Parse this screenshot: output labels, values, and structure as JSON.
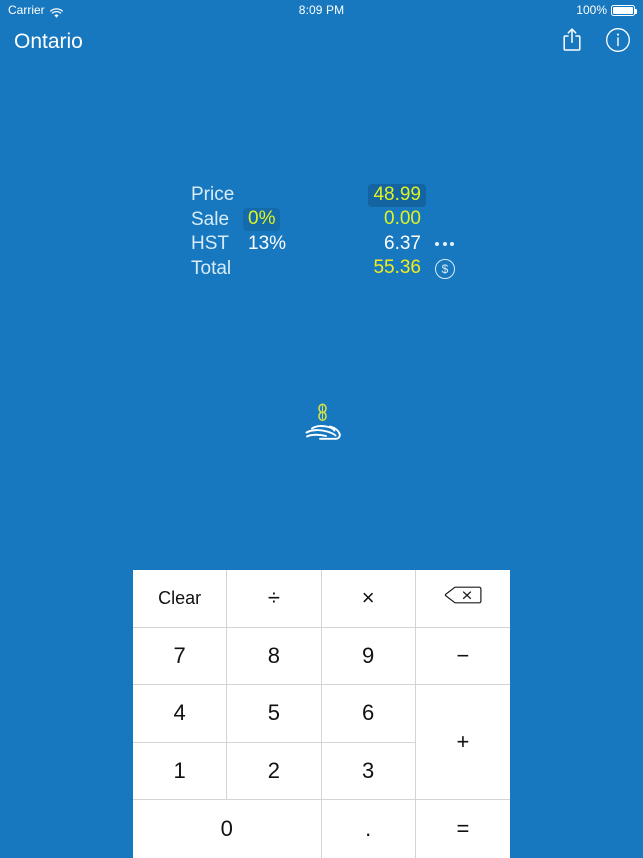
{
  "status_bar": {
    "carrier": "Carrier",
    "wifi_icon": "wifi-icon",
    "time": "8:09 PM",
    "battery_percent": "100%",
    "battery_icon": "battery-full-icon"
  },
  "nav_bar": {
    "title": "Ontario",
    "share_icon": "share-icon",
    "info_icon": "info-circle-icon"
  },
  "receipt": {
    "rows": [
      {
        "label": "Price",
        "percent": "",
        "value": "48.99",
        "value_style": "green boxed",
        "trailing": ""
      },
      {
        "label": "Sale",
        "percent": "0%",
        "value": "0.00",
        "value_style": "green",
        "trailing": ""
      },
      {
        "label": "HST",
        "percent": "13%",
        "value": "6.37",
        "value_style": "white",
        "trailing": "more-dots-icon"
      },
      {
        "label": "Total",
        "percent": "",
        "value": "55.36",
        "value_style": "yellow",
        "trailing": "dollar-circle-icon"
      }
    ]
  },
  "logo": {
    "icon": "hand-holding-coins-icon"
  },
  "keypad": {
    "keys": [
      {
        "label": "Clear",
        "name": "key-clear"
      },
      {
        "label": "÷",
        "name": "key-divide"
      },
      {
        "label": "×",
        "name": "key-multiply"
      },
      {
        "label": "",
        "name": "key-backspace",
        "icon": "backspace-icon"
      },
      {
        "label": "7",
        "name": "key-7"
      },
      {
        "label": "8",
        "name": "key-8"
      },
      {
        "label": "9",
        "name": "key-9"
      },
      {
        "label": "−",
        "name": "key-minus"
      },
      {
        "label": "4",
        "name": "key-4"
      },
      {
        "label": "5",
        "name": "key-5"
      },
      {
        "label": "6",
        "name": "key-6"
      },
      {
        "label": "+",
        "name": "key-plus"
      },
      {
        "label": "1",
        "name": "key-1"
      },
      {
        "label": "2",
        "name": "key-2"
      },
      {
        "label": "3",
        "name": "key-3"
      },
      {
        "label": "0",
        "name": "key-0"
      },
      {
        "label": ".",
        "name": "key-decimal"
      },
      {
        "label": "=",
        "name": "key-equals"
      }
    ]
  },
  "colors": {
    "background_blue": "#1778bf",
    "keypad_white": "#ffffff",
    "value_yellow": "#f2ec1e",
    "value_green": "#dff224",
    "label_light": "#d8ecf8",
    "key_border": "#d4d4d4"
  }
}
